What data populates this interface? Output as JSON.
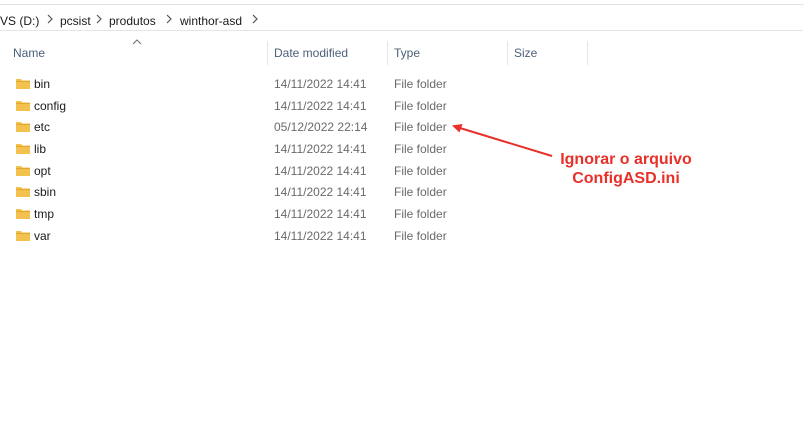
{
  "address_bar": {
    "crumbs": [
      "VS (D:)",
      "pcsist",
      "produtos",
      "winthor-asd"
    ]
  },
  "columns": {
    "name": "Name",
    "date_modified": "Date modified",
    "type": "Type",
    "size": "Size"
  },
  "sort": {
    "column": "name",
    "direction": "ascending"
  },
  "files": [
    {
      "name": "bin",
      "date": "14/11/2022 14:41",
      "type": "File folder"
    },
    {
      "name": "config",
      "date": "14/11/2022 14:41",
      "type": "File folder"
    },
    {
      "name": "etc",
      "date": "05/12/2022 22:14",
      "type": "File folder"
    },
    {
      "name": "lib",
      "date": "14/11/2022 14:41",
      "type": "File folder"
    },
    {
      "name": "opt",
      "date": "14/11/2022 14:41",
      "type": "File folder"
    },
    {
      "name": "sbin",
      "date": "14/11/2022 14:41",
      "type": "File folder"
    },
    {
      "name": "tmp",
      "date": "14/11/2022 14:41",
      "type": "File folder"
    },
    {
      "name": "var",
      "date": "14/11/2022 14:41",
      "type": "File folder"
    }
  ],
  "annotation": {
    "line1": "Ignorar o arquivo",
    "line2": "ConfigASD.ini",
    "color": "#e8302a"
  },
  "colors": {
    "folder": "#f2c14e",
    "folder_dark": "#e2a72e",
    "header_text": "#4c607a"
  },
  "icons": {
    "breadcrumb_separator": "chevron-right-icon",
    "sort": "sort-ascending-icon",
    "folder": "folder-icon"
  }
}
